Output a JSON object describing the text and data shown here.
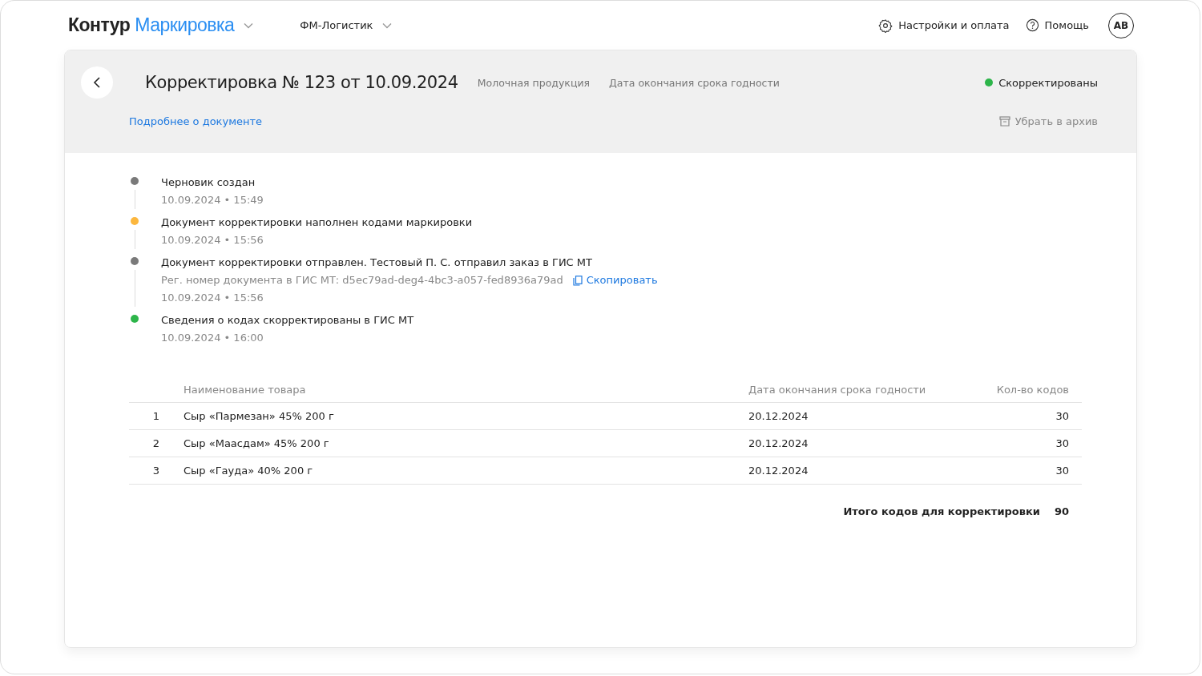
{
  "header": {
    "logo_brand": "Контур",
    "logo_product": "Маркировка",
    "organization": "ФМ-Логистик",
    "settings_link": "Настройки и оплата",
    "help_link": "Помощь",
    "avatar": "АВ"
  },
  "document": {
    "title": "Корректировка № 123 от 10.09.2024",
    "tags": [
      "Молочная продукция",
      "Дата окончания срока годности"
    ],
    "status": {
      "label": "Скорректированы",
      "color": "#2db54a"
    },
    "details_link": "Подробнее о документе",
    "archive_button": "Убрать в архив"
  },
  "timeline": [
    {
      "title": "Черновик создан",
      "time": "10.09.2024 • 15:49",
      "color": "#7a7a7a"
    },
    {
      "title": "Документ корректировки наполнен кодами маркировки",
      "time": "10.09.2024 • 15:56",
      "color": "#fcb73e"
    },
    {
      "title": "Документ корректировки отправлен. Тестовый П. С. отправил заказ в ГИС МТ",
      "note": "Рег. номер документа в ГИС МТ: d5ec79ad-deg4-4bc3-a057-fed8936a79ad",
      "copy_link": "Скопировать",
      "time": "10.09.2024 • 15:56",
      "color": "#7a7a7a"
    },
    {
      "title": "Сведения о кодах скорректированы в ГИС МТ",
      "time": "10.09.2024 • 16:00",
      "color": "#2db54a"
    }
  ],
  "table": {
    "columns": [
      "Наименование товара",
      "Дата окончания срока годности",
      "Кол-во кодов"
    ],
    "rows": [
      {
        "index": "1",
        "name": "Сыр «Пармезан» 45% 200 г",
        "date": "20.12.2024",
        "count": "30"
      },
      {
        "index": "2",
        "name": "Сыр «Маасдам» 45% 200 г",
        "date": "20.12.2024",
        "count": "30"
      },
      {
        "index": "3",
        "name": "Сыр «Гауда» 40% 200 г",
        "date": "20.12.2024",
        "count": "30"
      }
    ],
    "total_label": "Итого кодов для корректировки",
    "total_value": "90"
  }
}
